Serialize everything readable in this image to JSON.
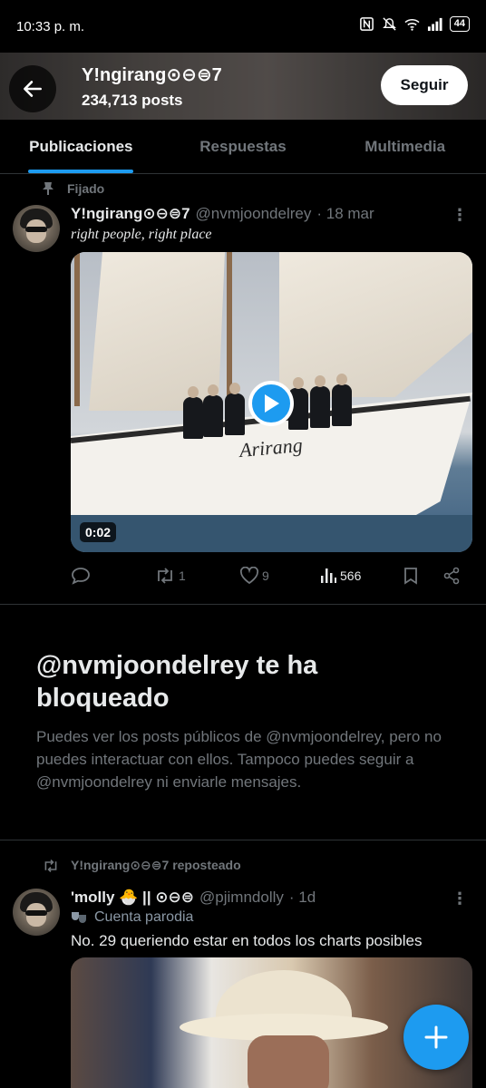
{
  "status_bar": {
    "time": "10:33 p. m.",
    "battery": "44",
    "icons": [
      "nfc-icon",
      "mute-icon",
      "wifi-icon",
      "signal-icon",
      "battery-icon"
    ]
  },
  "header": {
    "display_name": "Y!ngirang⊙⊖⊜7",
    "post_count": "234,713 posts",
    "follow_label": "Seguir"
  },
  "tabs": [
    {
      "label": "Publicaciones",
      "active": true
    },
    {
      "label": "Respuestas",
      "active": false
    },
    {
      "label": "Multimedia",
      "active": false
    }
  ],
  "pinned_post": {
    "pinned_label": "Fijado",
    "author_name": "Y!ngirang⊙⊖⊜7",
    "handle": "@nvmjoondelrey",
    "time": "· 18 mar",
    "text": "right people, right place",
    "video_duration": "0:02",
    "ship_name": "Arirang",
    "replies": "",
    "reposts": "1",
    "likes": "9",
    "views": "566"
  },
  "blocked_notice": {
    "title": "@nvmjoondelrey te ha bloqueado",
    "description": "Puedes ver los posts públicos de @nvmjoondelrey, pero no puedes interactuar con ellos. Tampoco puedes seguir a @nvmjoondelrey ni enviarle mensajes."
  },
  "repost": {
    "reposter_label": "Y!ngirang⊙⊖⊜7 reposteado",
    "author_name": "'molly 🐣 || ⊙⊖⊜",
    "handle": "@pjimndolly",
    "time": "· 1d",
    "parody_label": "Cuenta parodia",
    "text": "No. 29 queriendo estar en todos los charts posibles"
  },
  "colors": {
    "accent": "#1d9bf0",
    "background": "#000000",
    "primary_text": "#e7e9ea",
    "secondary_text": "#71767b",
    "divider": "#2f3336"
  }
}
